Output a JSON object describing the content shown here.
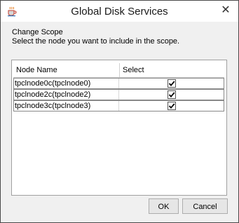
{
  "window": {
    "title": "Global Disk Services",
    "icon": "java-coffee-icon",
    "close_glyph": "✕"
  },
  "header": {
    "line1": "Change Scope",
    "line2": "Select the node you want to include in the scope."
  },
  "table": {
    "columns": [
      "Node Name",
      "Select"
    ],
    "rows": [
      {
        "name": "tpclnode0c(tpclnode0)",
        "selected": true
      },
      {
        "name": "tpclnode2c(tpclnode2)",
        "selected": true
      },
      {
        "name": "tpclnode3c(tpclnode3)",
        "selected": true
      }
    ]
  },
  "buttons": {
    "ok": "OK",
    "cancel": "Cancel"
  },
  "colors": {
    "window_bg": "#f0f0f0",
    "titlebar_bg": "#ffffff",
    "table_bg": "#ffffff"
  }
}
